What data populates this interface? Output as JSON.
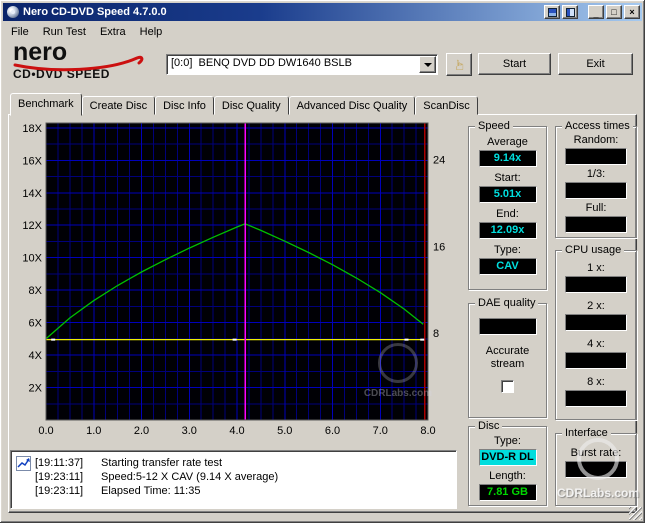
{
  "watermark": "CDRLabs.com",
  "titlebar": {
    "title": "Nero CD-DVD Speed 4.7.0.0",
    "minimize_glyph": "_",
    "maximize_glyph": "□",
    "close_glyph": "×"
  },
  "menu": {
    "items": [
      "File",
      "Run Test",
      "Extra",
      "Help"
    ]
  },
  "logo": {
    "brand": "nero",
    "product": "CD•DVD SPEED"
  },
  "toolbar": {
    "drive_selector": "[0:0]  BENQ DVD DD DW1640 BSLB",
    "start_button": "Start",
    "exit_button": "Exit"
  },
  "icons": {
    "hand": "☞"
  },
  "tabs": {
    "items": [
      "Benchmark",
      "Create Disc",
      "Disc Info",
      "Disc Quality",
      "Advanced Disc Quality",
      "ScanDisc"
    ],
    "active": "Benchmark"
  },
  "panels": {
    "speed": {
      "title": "Speed",
      "average_label": "Average",
      "average_value": "9.14x",
      "start_label": "Start:",
      "start_value": "5.01x",
      "end_label": "End:",
      "end_value": "12.09x",
      "type_label": "Type:",
      "type_value": "CAV"
    },
    "access_times": {
      "title": "Access times",
      "random_label": "Random:",
      "random_value": "",
      "third_label": "1/3:",
      "third_value": "",
      "full_label": "Full:",
      "full_value": ""
    },
    "cpu_usage": {
      "title": "CPU usage",
      "x1_label": "1 x:",
      "x1_value": "",
      "x2_label": "2 x:",
      "x2_value": "",
      "x4_label": "4 x:",
      "x4_value": "",
      "x8_label": "8 x:",
      "x8_value": ""
    },
    "dae_quality": {
      "title": "DAE quality",
      "quality_value": "",
      "accurate_stream_label": "Accurate stream",
      "accurate_stream_checked": false
    },
    "disc": {
      "title": "Disc",
      "type_label": "Type:",
      "type_value": "DVD-R DL",
      "length_label": "Length:",
      "length_value": "7.81 GB"
    },
    "interface": {
      "title": "Interface",
      "burst_label": "Burst rate:",
      "burst_value": ""
    }
  },
  "log": {
    "entries": [
      {
        "time": "[19:11:37]",
        "text": "Starting transfer rate test"
      },
      {
        "time": "[19:23:11]",
        "text": "Speed:5-12 X CAV (9.14 X average)"
      },
      {
        "time": "[19:23:11]",
        "text": "Elapsed Time: 11:35"
      }
    ]
  },
  "chart_data": {
    "type": "line",
    "title": "",
    "xlim": [
      0,
      8.0
    ],
    "x_ticks": [
      0,
      1,
      2,
      3,
      4,
      5,
      6,
      7,
      8
    ],
    "x_tick_labels": [
      "0.0",
      "1.0",
      "2.0",
      "3.0",
      "4.0",
      "5.0",
      "6.0",
      "7.0",
      "8.0"
    ],
    "ylim_left": [
      0,
      18.3
    ],
    "y_ticks_left": [
      2,
      4,
      6,
      8,
      10,
      12,
      14,
      16,
      18
    ],
    "y_tick_labels_left": [
      "2X",
      "4X",
      "6X",
      "8X",
      "10X",
      "12X",
      "14X",
      "16X",
      "18X"
    ],
    "ylim_right": [
      0,
      27.35
    ],
    "y_ticks_right": [
      8,
      16,
      24
    ],
    "y_tick_labels_right": [
      "8",
      "16",
      "24"
    ],
    "grid": {
      "minor_x": 0.25,
      "major_x": 1,
      "minor_y": 1,
      "major_y": 2,
      "minor_color": "#00007a",
      "major_color": "#0000bb",
      "bg": "#000005"
    },
    "series": [
      {
        "name": "read-speed",
        "color": "#00c000",
        "axis": "left",
        "x": [
          0,
          0.5,
          1,
          1.5,
          2,
          2.5,
          3,
          3.5,
          4,
          4.17,
          4.5,
          5,
          5.5,
          6,
          6.5,
          7,
          7.5,
          7.9
        ],
        "y": [
          5.01,
          6.29,
          7.36,
          8.29,
          9.12,
          9.88,
          10.59,
          11.26,
          11.89,
          12.09,
          11.68,
          11.02,
          10.32,
          9.57,
          8.75,
          7.85,
          6.84,
          5.9
        ]
      },
      {
        "name": "rotation-speed",
        "color": "#f0f000",
        "axis": "right",
        "x": [
          0,
          7.9
        ],
        "y": [
          7.4,
          7.4
        ]
      }
    ],
    "markers": [
      {
        "type": "vline",
        "x": 4.17,
        "color": "#ff00ff",
        "name": "layer-break-line"
      },
      {
        "type": "vline",
        "x": 7.93,
        "color": "#aa0000",
        "name": "end-position-line"
      }
    ],
    "white_marks": {
      "color": "#ffffff",
      "axis": "right",
      "y": 7.4,
      "x": [
        0.15,
        3.95,
        7.55,
        7.88
      ]
    }
  }
}
